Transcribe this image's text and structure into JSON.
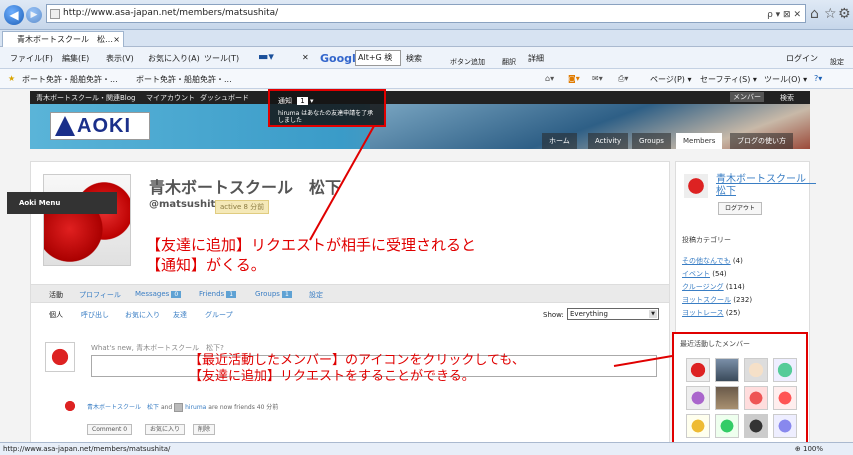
{
  "browser": {
    "url": "http://www.asa-japan.net/members/matsushita/",
    "tab_title": "青木ボートスクール　松…",
    "tab_close": "×",
    "url_controls": "ρ ▾ ⊠ ✕",
    "login": "ログイン",
    "settings": "設定",
    "menu": [
      "ファイル(F)",
      "編集(E)",
      "表示(V)",
      "お気に入り(A)",
      "ツール(T)"
    ],
    "google_label": "Google",
    "google_search": "Alt+G 検",
    "search_btn": "検索",
    "button_add": "ボタン追加",
    "translate": "翻訳",
    "detail": "詳細",
    "favorites": [
      "ボート免許・船舶免許・...",
      "ボート免許・船舶免許・..."
    ],
    "cmdbar": [
      "ページ(P) ▾",
      "セーフティ(S) ▾",
      "ツール(O) ▾"
    ],
    "status_url": "http://www.asa-japan.net/members/matsushita/",
    "zoom": "100%"
  },
  "site": {
    "adminbar": [
      "青木ボートスクール・関連Blog",
      "マイアカウント",
      "ダッシュボード"
    ],
    "logo_text": "AOKI",
    "nav": [
      "ホーム",
      "Activity",
      "Groups",
      "Members",
      "ブログの使い方"
    ],
    "member_select": "メンバー",
    "search_label": "検索",
    "notification": {
      "label": "通知",
      "count": "1",
      "message": "hiruma はあなたの友達申請を了承しました"
    },
    "left_menu": "Aoki Menu"
  },
  "profile": {
    "name": "青木ボートスクール　松下",
    "handle": "@matsushita",
    "active": "active 8 分前"
  },
  "annotations": {
    "a1_line1": "【友達に追加】リクエストが相手に受理されると",
    "a1_line2": "【通知】がくる。",
    "a2_line1": "【最近活動したメンバー】のアイコンをクリックしても、",
    "a2_line2": "【友達に追加】リクエストをすることができる。"
  },
  "tabs": {
    "activity": "活動",
    "profile": "プロフィール",
    "messages": "Messages",
    "messages_count": "0",
    "friends": "Friends",
    "friends_count": "1",
    "groups": "Groups",
    "groups_count": "1",
    "settings": "設定"
  },
  "subtabs": [
    "個人",
    "呼び出し",
    "お気に入り",
    "友達",
    "グループ"
  ],
  "show": {
    "label": "Show:",
    "value": "Everything"
  },
  "post": {
    "prompt": "What's new, 青木ボートスクール　松下?"
  },
  "activity": {
    "actor": "青木ボートスクール　松下",
    "and": "and",
    "friend": "hiruma",
    "rest": "are now friends 40 分前",
    "buttons": [
      "Comment 0",
      "お気に入り",
      "削除"
    ]
  },
  "sidebar": {
    "name": "青木ボートスクール　松下",
    "logout": "ログアウト",
    "cat_title": "投稿カテゴリー",
    "categories": [
      {
        "name": "その他なんでも",
        "count": "(4)"
      },
      {
        "name": "イベント",
        "count": "(54)"
      },
      {
        "name": "クルージング",
        "count": "(114)"
      },
      {
        "name": "ヨットスクール",
        "count": "(232)"
      },
      {
        "name": "ヨットレース",
        "count": "(25)"
      }
    ],
    "members_title": "最近活動したメンバー"
  }
}
